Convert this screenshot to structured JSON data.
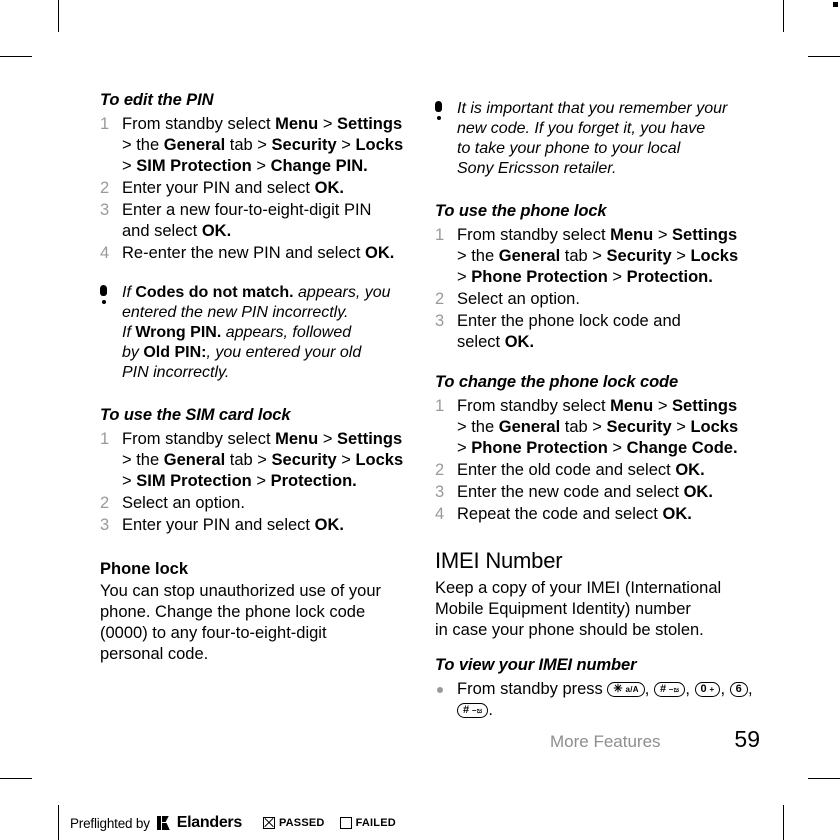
{
  "document": {
    "footer": {
      "section_title": "More Features",
      "page_number": "59"
    },
    "preflight": {
      "label": "Preflighted by",
      "brand": "Elanders",
      "passed_label": "PASSED",
      "failed_label": "FAILED",
      "passed_checked": true,
      "failed_checked": false
    }
  },
  "left_column": {
    "proc_edit_pin": {
      "heading": "To edit the PIN",
      "steps": [
        {
          "num": "1",
          "lines": [
            {
              "parts": [
                {
                  "t": "From standby select ",
                  "b": false
                },
                {
                  "t": "Menu",
                  "b": true
                },
                {
                  "t": " > ",
                  "b": false
                },
                {
                  "t": "Settings",
                  "b": true
                }
              ]
            },
            {
              "parts": [
                {
                  "t": "> the ",
                  "b": false
                },
                {
                  "t": "General",
                  "b": true
                },
                {
                  "t": " tab > ",
                  "b": false
                },
                {
                  "t": "Security",
                  "b": true
                },
                {
                  "t": " > ",
                  "b": false
                },
                {
                  "t": "Locks",
                  "b": true
                }
              ]
            },
            {
              "parts": [
                {
                  "t": "> ",
                  "b": false
                },
                {
                  "t": "SIM Protection",
                  "b": true
                },
                {
                  "t": " > ",
                  "b": false
                },
                {
                  "t": "Change PIN.",
                  "b": true
                }
              ]
            }
          ]
        },
        {
          "num": "2",
          "lines": [
            {
              "parts": [
                {
                  "t": "Enter your PIN and select ",
                  "b": false
                },
                {
                  "t": "OK.",
                  "b": true
                }
              ]
            }
          ]
        },
        {
          "num": "3",
          "lines": [
            {
              "parts": [
                {
                  "t": "Enter a new four-to-eight-digit PIN",
                  "b": false
                }
              ]
            },
            {
              "parts": [
                {
                  "t": "and select ",
                  "b": false
                },
                {
                  "t": "OK.",
                  "b": true
                }
              ]
            }
          ]
        },
        {
          "num": "4",
          "lines": [
            {
              "parts": [
                {
                  "t": "Re-enter the new PIN and select ",
                  "b": false
                },
                {
                  "t": "OK.",
                  "b": true
                }
              ]
            }
          ]
        }
      ]
    },
    "note_codes": {
      "icon": "exclamation-icon",
      "lines": [
        {
          "parts": [
            {
              "t": "If ",
              "b": false
            },
            {
              "t": "Codes do not match.",
              "b": true
            },
            {
              "t": " appears, you",
              "b": false
            }
          ]
        },
        {
          "parts": [
            {
              "t": "entered the new PIN incorrectly.",
              "b": false
            }
          ]
        },
        {
          "parts": [
            {
              "t": "If ",
              "b": false
            },
            {
              "t": "Wrong PIN.",
              "b": true
            },
            {
              "t": " appears, followed",
              "b": false
            }
          ]
        },
        {
          "parts": [
            {
              "t": "by ",
              "b": false
            },
            {
              "t": "Old PIN:",
              "b": true
            },
            {
              "t": ", you entered your old",
              "b": false
            }
          ]
        },
        {
          "parts": [
            {
              "t": "PIN incorrectly.",
              "b": false
            }
          ]
        }
      ]
    },
    "proc_sim_card_lock": {
      "heading": "To use the SIM card lock",
      "steps": [
        {
          "num": "1",
          "lines": [
            {
              "parts": [
                {
                  "t": "From standby select ",
                  "b": false
                },
                {
                  "t": "Menu",
                  "b": true
                },
                {
                  "t": " > ",
                  "b": false
                },
                {
                  "t": "Settings",
                  "b": true
                }
              ]
            },
            {
              "parts": [
                {
                  "t": "> the ",
                  "b": false
                },
                {
                  "t": "General",
                  "b": true
                },
                {
                  "t": " tab > ",
                  "b": false
                },
                {
                  "t": "Security",
                  "b": true
                },
                {
                  "t": " > ",
                  "b": false
                },
                {
                  "t": "Locks",
                  "b": true
                }
              ]
            },
            {
              "parts": [
                {
                  "t": "> ",
                  "b": false
                },
                {
                  "t": "SIM Protection",
                  "b": true
                },
                {
                  "t": " > ",
                  "b": false
                },
                {
                  "t": "Protection.",
                  "b": true
                }
              ]
            }
          ]
        },
        {
          "num": "2",
          "lines": [
            {
              "parts": [
                {
                  "t": "Select an option.",
                  "b": false
                }
              ]
            }
          ]
        },
        {
          "num": "3",
          "lines": [
            {
              "parts": [
                {
                  "t": "Enter your PIN and select ",
                  "b": false
                },
                {
                  "t": "OK.",
                  "b": true
                }
              ]
            }
          ]
        }
      ]
    },
    "phone_lock": {
      "heading": "Phone lock",
      "body_lines": [
        "You can stop unauthorized use of your",
        "phone. Change the phone lock code",
        "(0000) to any four-to-eight-digit",
        "personal code."
      ]
    }
  },
  "right_column": {
    "note_remember": {
      "icon": "exclamation-icon",
      "lines": [
        {
          "parts": [
            {
              "t": "It is important that you remember your",
              "b": false
            }
          ]
        },
        {
          "parts": [
            {
              "t": "new code. If you forget it, you have",
              "b": false
            }
          ]
        },
        {
          "parts": [
            {
              "t": "to take your phone to your local",
              "b": false
            }
          ]
        },
        {
          "parts": [
            {
              "t": "Sony Ericsson retailer.",
              "b": false
            }
          ]
        }
      ]
    },
    "proc_use_phone_lock": {
      "heading": "To use the phone lock",
      "steps": [
        {
          "num": "1",
          "lines": [
            {
              "parts": [
                {
                  "t": "From standby select ",
                  "b": false
                },
                {
                  "t": "Menu",
                  "b": true
                },
                {
                  "t": " > ",
                  "b": false
                },
                {
                  "t": "Settings",
                  "b": true
                }
              ]
            },
            {
              "parts": [
                {
                  "t": "> the ",
                  "b": false
                },
                {
                  "t": "General",
                  "b": true
                },
                {
                  "t": " tab > ",
                  "b": false
                },
                {
                  "t": "Security",
                  "b": true
                },
                {
                  "t": " > ",
                  "b": false
                },
                {
                  "t": "Locks",
                  "b": true
                }
              ]
            },
            {
              "parts": [
                {
                  "t": "> ",
                  "b": false
                },
                {
                  "t": "Phone Protection",
                  "b": true
                },
                {
                  "t": " > ",
                  "b": false
                },
                {
                  "t": "Protection.",
                  "b": true
                }
              ]
            }
          ]
        },
        {
          "num": "2",
          "lines": [
            {
              "parts": [
                {
                  "t": "Select an option.",
                  "b": false
                }
              ]
            }
          ]
        },
        {
          "num": "3",
          "lines": [
            {
              "parts": [
                {
                  "t": "Enter the phone lock code and",
                  "b": false
                }
              ]
            },
            {
              "parts": [
                {
                  "t": "select ",
                  "b": false
                },
                {
                  "t": "OK.",
                  "b": true
                }
              ]
            }
          ]
        }
      ]
    },
    "proc_change_phone_lock_code": {
      "heading": "To change the phone lock code",
      "steps": [
        {
          "num": "1",
          "lines": [
            {
              "parts": [
                {
                  "t": "From standby select ",
                  "b": false
                },
                {
                  "t": "Menu",
                  "b": true
                },
                {
                  "t": " > ",
                  "b": false
                },
                {
                  "t": "Settings",
                  "b": true
                }
              ]
            },
            {
              "parts": [
                {
                  "t": "> the ",
                  "b": false
                },
                {
                  "t": "General",
                  "b": true
                },
                {
                  "t": " tab > ",
                  "b": false
                },
                {
                  "t": "Security",
                  "b": true
                },
                {
                  "t": " > ",
                  "b": false
                },
                {
                  "t": "Locks",
                  "b": true
                }
              ]
            },
            {
              "parts": [
                {
                  "t": "> ",
                  "b": false
                },
                {
                  "t": "Phone Protection",
                  "b": true
                },
                {
                  "t": " > ",
                  "b": false
                },
                {
                  "t": "Change Code.",
                  "b": true
                }
              ]
            }
          ]
        },
        {
          "num": "2",
          "lines": [
            {
              "parts": [
                {
                  "t": "Enter the old code and select ",
                  "b": false
                },
                {
                  "t": "OK.",
                  "b": true
                }
              ]
            }
          ]
        },
        {
          "num": "3",
          "lines": [
            {
              "parts": [
                {
                  "t": "Enter the new code and select ",
                  "b": false
                },
                {
                  "t": "OK.",
                  "b": true
                }
              ]
            }
          ]
        },
        {
          "num": "4",
          "lines": [
            {
              "parts": [
                {
                  "t": "Repeat the code and select ",
                  "b": false
                },
                {
                  "t": "OK.",
                  "b": true
                }
              ]
            }
          ]
        }
      ]
    },
    "imei": {
      "heading": "IMEI Number",
      "body_lines": [
        "Keep a copy of your IMEI (International",
        "Mobile Equipment Identity) number",
        "in case your phone should be stolen."
      ],
      "proc_heading": "To view your IMEI number",
      "bullet_prefix": "From standby press ",
      "keys": [
        {
          "name": "star-key",
          "big": "✳",
          "small": "a/A",
          "after": ", "
        },
        {
          "name": "hash-key-1",
          "big": "#",
          "small": "–ಜ",
          "after": ", "
        },
        {
          "name": "zero-key",
          "big": "0",
          "small": "+",
          "after": ", "
        },
        {
          "name": "six-key",
          "big": "6",
          "small": "",
          "after": ", "
        },
        {
          "name": "hash-key-2",
          "big": "#",
          "small": "–ಜ",
          "after": "."
        }
      ]
    }
  }
}
